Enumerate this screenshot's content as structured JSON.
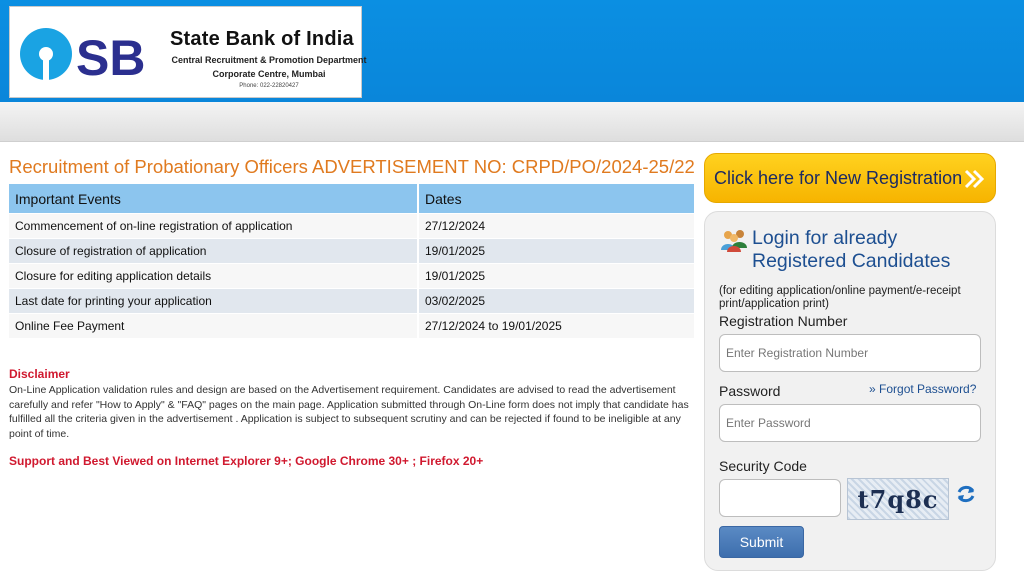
{
  "header": {
    "logo_text": "SBI",
    "bank_name": "State Bank of India",
    "department": "Central Recruitment & Promotion Department",
    "centre": "Corporate Centre, Mumbai",
    "phone": "Phone: 022-22820427"
  },
  "main": {
    "title": "Recruitment of Probationary Officers ADVERTISEMENT NO: CRPD/PO/2024-25/22",
    "table": {
      "headers": [
        "Important Events",
        "Dates"
      ],
      "rows": [
        [
          "Commencement of on-line registration of application",
          "27/12/2024"
        ],
        [
          "Closure of registration of application",
          "19/01/2025"
        ],
        [
          "Closure for editing application details",
          "19/01/2025"
        ],
        [
          "Last date for printing your application",
          "03/02/2025"
        ],
        [
          "Online Fee Payment",
          "27/12/2024 to 19/01/2025"
        ]
      ]
    },
    "disclaimer_title": "Disclaimer",
    "disclaimer_text": "On-Line Application validation rules and design are based on the Advertisement requirement. Candidates are advised to read the advertisement carefully and refer \"How to Apply\" & \"FAQ\" pages on the main page. Application submitted through On-Line form does not imply that candidate has fulfilled all the criteria given in the advertisement . Application is subject to subsequent scrutiny and can be rejected if found to be ineligible at any point of time.",
    "support_text": "Support and Best Viewed on Internet Explorer 9+; Google Chrome 30+ ; Firefox 20+"
  },
  "sidebar": {
    "new_registration_label": "Click here for New Registration",
    "login_title_line1": "Login for already",
    "login_title_line2": "Registered Candidates",
    "login_note": "(for editing application/online payment/e-receipt print/application print)",
    "registration_number_label": "Registration Number",
    "registration_number_placeholder": "Enter Registration Number",
    "registration_number_value": "",
    "password_label": "Password",
    "password_placeholder": "Enter Password",
    "password_value": "",
    "forgot_password_label": "Forgot Password?",
    "security_code_label": "Security Code",
    "security_code_value": "",
    "captcha_text": "t7q8c",
    "submit_label": "Submit"
  },
  "colors": {
    "header_blue": "#0a8ae0",
    "title_orange": "#e07a1f",
    "table_header": "#8cc5ee",
    "disclaimer_red": "#d0192f",
    "register_button_yellow": "#f9c40c",
    "login_title_blue": "#1d4f91",
    "submit_blue": "#4a7cbb"
  },
  "icons": [
    "sbi-logo",
    "double-chevron-right-icon",
    "people-icon",
    "refresh-icon"
  ]
}
